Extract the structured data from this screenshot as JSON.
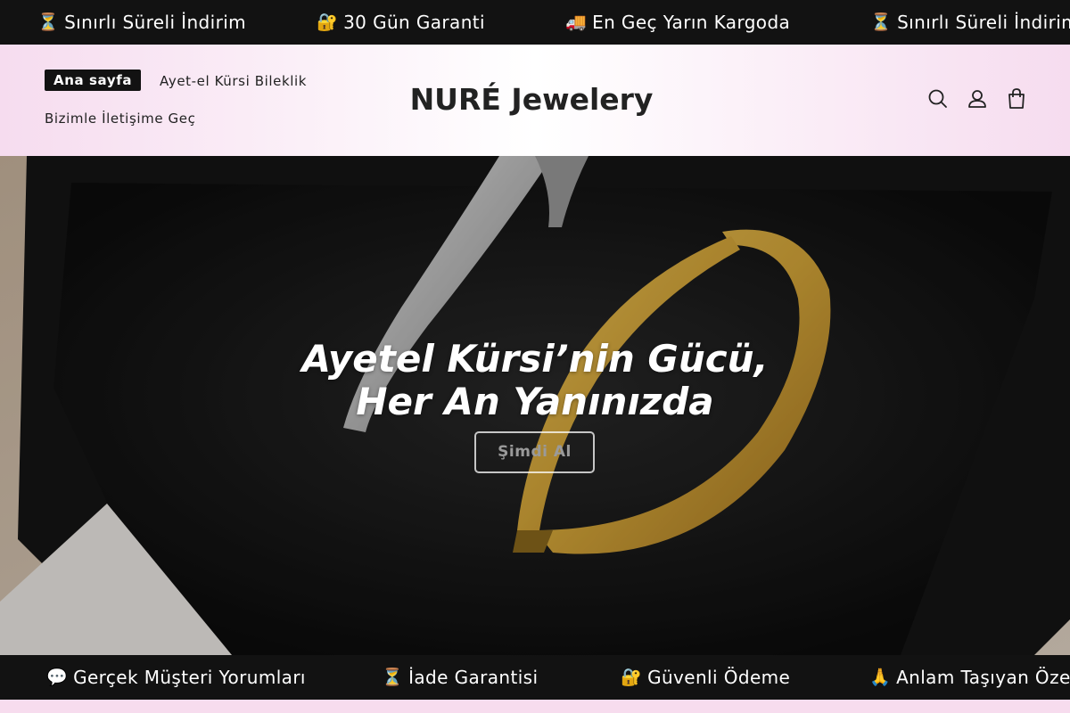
{
  "announcement_bar": {
    "items": [
      {
        "emoji": "⏳",
        "text": "Sınırlı Süreli İndirim"
      },
      {
        "emoji": "🔐",
        "text": "30 Gün Garanti"
      },
      {
        "emoji": "🚚",
        "text": "En Geç Yarın Kargoda"
      },
      {
        "emoji": "⏳",
        "text": "Sınırlı Süreli İndirim"
      }
    ]
  },
  "header": {
    "nav": {
      "home": "Ana sayfa",
      "bracelet": "Ayet-el Kürsi Bileklik",
      "contact": "Bizimle İletişime Geç"
    },
    "logo": "NURÉ Jewelery",
    "icons": [
      "search-icon",
      "account-icon",
      "cart-icon"
    ]
  },
  "hero": {
    "title_line1": "Ayetel Kürsi’nin Gücü,",
    "title_line2": "Her An Yanınızda",
    "button_label": "Şimdi Al"
  },
  "trust_bar": {
    "items": [
      {
        "emoji": "💬",
        "text": "Gerçek Müşteri Yorumları"
      },
      {
        "emoji": "⏳",
        "text": "İade Garantisi"
      },
      {
        "emoji": "🔐",
        "text": "Güvenli Ödeme"
      },
      {
        "emoji": "🙏",
        "text": "Anlam Taşıyan Özel"
      }
    ]
  },
  "colors": {
    "bar_bg": "#121212",
    "header_tint": "#f6dcef",
    "gold": "#d9a93a",
    "silver": "#c8c8c8"
  }
}
